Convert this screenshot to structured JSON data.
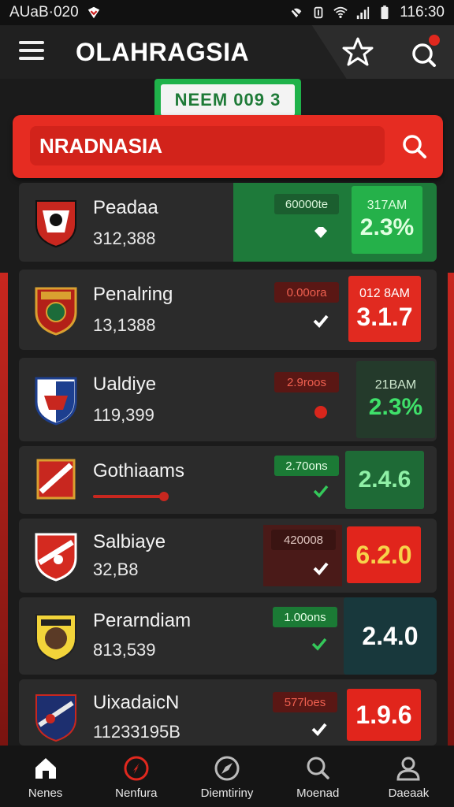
{
  "status_bar": {
    "left_text": "AUaB·020",
    "time": "116:30"
  },
  "header": {
    "title": "OLAHRAGSIA",
    "notification_count": ""
  },
  "tab_pill": {
    "label": "NEEM 009 3"
  },
  "search": {
    "placeholder": "NRADNASIA"
  },
  "colors": {
    "accent_red": "#e62c22",
    "accent_green": "#1fb24a",
    "dark_bg": "#1b1b1b"
  },
  "rows": [
    {
      "name": "Peadaa",
      "count": "312,388",
      "odds": "60000te",
      "value_sub": "317AM",
      "value": "2.3%",
      "status": "green",
      "mark": "diamond"
    },
    {
      "name": "Penalring",
      "count": "13,1388",
      "odds": "0.00ora",
      "value_sub": "012 8AM",
      "value": "3.1.7",
      "status": "red",
      "mark": "check"
    },
    {
      "name": "Ualdiye",
      "count": "119,399",
      "odds": "2.9roos",
      "value_sub": "21BAM",
      "value": "2.3%",
      "status": "green",
      "mark": "dot"
    },
    {
      "name": "Gothiaams",
      "count": "",
      "odds": "2.70ons",
      "value_sub": "",
      "value": "2.4.6",
      "status": "green",
      "mark": "check"
    },
    {
      "name": "Salbiaye",
      "count": "32,B8",
      "odds": "420008",
      "value_sub": "",
      "value": "6.2.0",
      "status": "red",
      "mark": "check"
    },
    {
      "name": "Perarndiam",
      "count": "813,539",
      "odds": "1.00ons",
      "value_sub": "",
      "value": "2.4.0",
      "status": "teal",
      "mark": "check"
    },
    {
      "name": "UixadaicN",
      "count": "11233195B",
      "odds": "577loes",
      "value_sub": "",
      "value": "1.9.6",
      "status": "red",
      "mark": "check"
    }
  ],
  "bottom_nav": [
    {
      "label": "Nenes",
      "icon": "home-icon"
    },
    {
      "label": "Nenfura",
      "icon": "flame-icon"
    },
    {
      "label": "Diemtiriny",
      "icon": "compass-icon"
    },
    {
      "label": "Moenad",
      "icon": "search-icon"
    },
    {
      "label": "Daeaak",
      "icon": "profile-icon"
    }
  ]
}
